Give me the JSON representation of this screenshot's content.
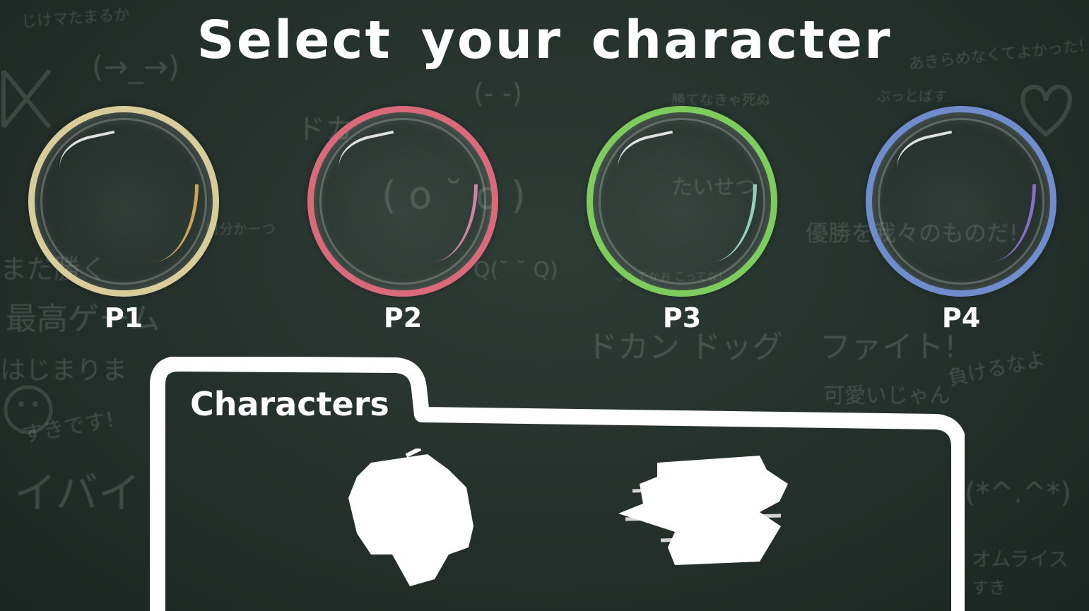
{
  "title": "Select your character",
  "players": [
    {
      "label": "P1",
      "ring_color": "#d8cc9a",
      "accent_color": "#e8b860"
    },
    {
      "label": "P2",
      "ring_color": "#d86a7a",
      "accent_color": "#e890b8"
    },
    {
      "label": "P3",
      "ring_color": "#7ecc5e",
      "accent_color": "#a8e8d8"
    },
    {
      "label": "P4",
      "ring_color": "#6f8ccc",
      "accent_color": "#9a7ae8"
    }
  ],
  "panel": {
    "tab_label": "Characters",
    "characters": [
      {
        "name": "character-scribble-1"
      },
      {
        "name": "character-scribble-2"
      }
    ]
  },
  "background_doodles": [
    "じけマたまるか",
    "(→_→)",
    "(- -)",
    "あきらめなくてよかった!",
    "ぶっとばす",
    "勝てなきゃ死ぬ",
    "ドカ",
    "( o ˘ o )",
    "たいせつ",
    "優勝を我々のものだ!",
    "自分かーつ",
    "まだ勝く",
    "最高ゲーム",
    "はじまりま",
    "Q(˘ ˘ Q)",
    "ふんでかお こってな!",
    "ドカン ドッグ",
    "ファイト!",
    "負けるなよ",
    "可愛いじゃん",
    "すきです!",
    "イバイ",
    "(*^.^*)",
    "オムライス",
    "すき"
  ]
}
